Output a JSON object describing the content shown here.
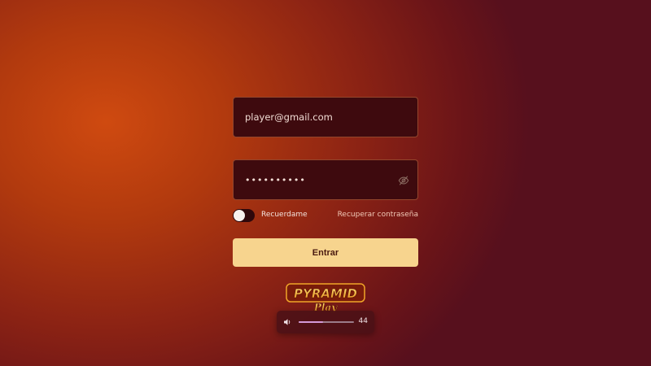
{
  "login": {
    "email_value": "player@gmail.com",
    "password_value": "••••••••••",
    "remember_label": "Recuerdame",
    "remember_enabled": false,
    "recover_label": "Recuperar contraseña",
    "submit_label": "Entrar"
  },
  "logo": {
    "text_top": "PYRAMID",
    "text_bottom": "Play"
  },
  "volume": {
    "value": "44",
    "level": 0.44
  },
  "icons": {
    "password_toggle": "eye-off-icon",
    "speaker": "speaker-icon"
  },
  "colors": {
    "background_orange": "#cf4a10",
    "background_maroon": "#57101d",
    "field_background": "#3e0a0e",
    "button": "#f7d48e",
    "button_text": "#4a1a10"
  }
}
